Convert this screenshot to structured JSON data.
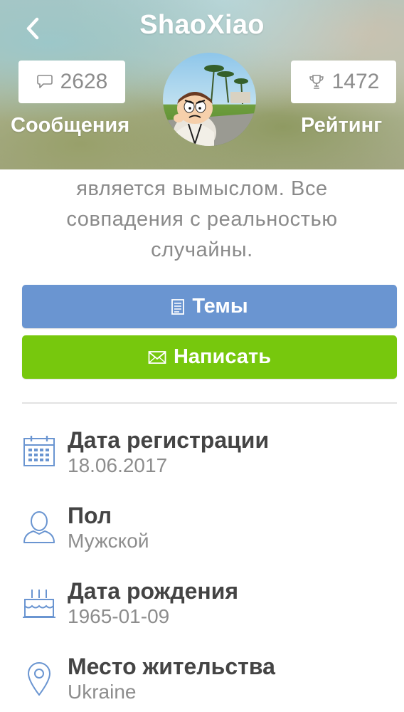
{
  "header": {
    "title": "ShaoXiao",
    "messages": {
      "count": "2628",
      "label": "Сообщения",
      "icon": "speech-bubble-icon"
    },
    "rating": {
      "count": "1472",
      "label": "Рейтинг",
      "icon": "trophy-icon"
    },
    "back_icon": "chevron-left-icon"
  },
  "about": {
    "lines": [
      "является вымыслом. Все",
      "совпадения с реальностью",
      "случайны."
    ]
  },
  "actions": {
    "topics_label": "Темы",
    "write_label": "Написать"
  },
  "info": [
    {
      "icon": "calendar-icon",
      "title": "Дата регистрации",
      "value": "18.06.2017"
    },
    {
      "icon": "user-icon",
      "title": "Пол",
      "value": "Мужской"
    },
    {
      "icon": "birthday-cake-icon",
      "title": "Дата рождения",
      "value": "1965-01-09"
    },
    {
      "icon": "location-pin-icon",
      "title": "Место жительства",
      "value": "Ukraine"
    }
  ],
  "colors": {
    "topics_button": "#6a95d1",
    "write_button": "#77c80d",
    "icon_blue": "#6a95d1",
    "title_text": "#444444",
    "value_text": "#8d8d8d"
  }
}
